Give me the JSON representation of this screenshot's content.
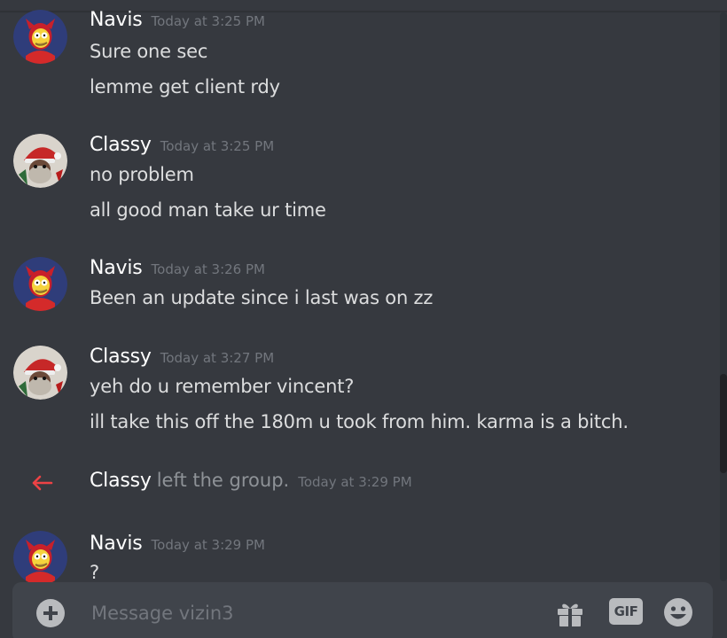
{
  "channel": {
    "placeholder": "Message vizin3"
  },
  "messages": [
    {
      "author": "Navis",
      "timestamp": "Today at 3:25 PM",
      "avatar": "simpson-devil-avatar",
      "lines": [
        "Sure one sec",
        "lemme get client rdy"
      ]
    },
    {
      "author": "Classy",
      "timestamp": "Today at 3:25 PM",
      "avatar": "santa-avatar",
      "lines": [
        "no problem",
        "all good man take ur time"
      ]
    },
    {
      "author": "Navis",
      "timestamp": "Today at 3:26 PM",
      "avatar": "simpson-devil-avatar",
      "lines": [
        "Been an update since i last was on zz"
      ]
    },
    {
      "author": "Classy",
      "timestamp": "Today at 3:27 PM",
      "avatar": "santa-avatar",
      "lines": [
        "yeh do u remember vincent?",
        "ill take this off the 180m u took from him. karma is a bitch."
      ]
    },
    {
      "author": "Navis",
      "timestamp": "Today at 3:29 PM",
      "avatar": "simpson-devil-avatar",
      "lines": [
        "?"
      ]
    }
  ],
  "system_event": {
    "icon": "left-arrow-icon",
    "actor": "Classy",
    "action": "left the group.",
    "timestamp": "Today at 3:29 PM"
  },
  "composer": {
    "add_icon": "plus-circle-icon",
    "gift_icon": "gift-icon",
    "gif_label": "GIF",
    "emoji_icon": "emoji-icon"
  },
  "colors": {
    "background": "#36393f",
    "composer_bg": "#40444b",
    "author": "#ffffff",
    "message_text": "#dcddde",
    "timestamp": "#72767d",
    "leave_arrow": "#ed4245"
  }
}
